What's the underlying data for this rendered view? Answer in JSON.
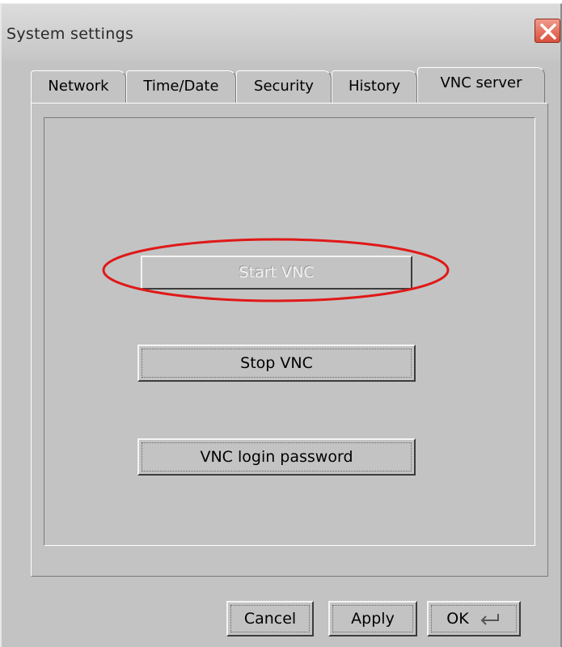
{
  "window": {
    "title": "System settings"
  },
  "tabs": [
    {
      "label": "Network"
    },
    {
      "label": "Time/Date"
    },
    {
      "label": "Security"
    },
    {
      "label": "History"
    },
    {
      "label": "VNC server",
      "active": true
    }
  ],
  "vnc_panel": {
    "start_label": "Start VNC",
    "start_enabled": false,
    "stop_label": "Stop VNC",
    "password_label": "VNC login password"
  },
  "footer": {
    "cancel_label": "Cancel",
    "apply_label": "Apply",
    "ok_label": "OK"
  },
  "colors": {
    "window_bg": "#c3c3c3",
    "highlight_ellipse": "#e01818",
    "close_button": "#d9503c"
  },
  "icons": {
    "close": "close-icon",
    "enter": "enter-key-icon"
  }
}
